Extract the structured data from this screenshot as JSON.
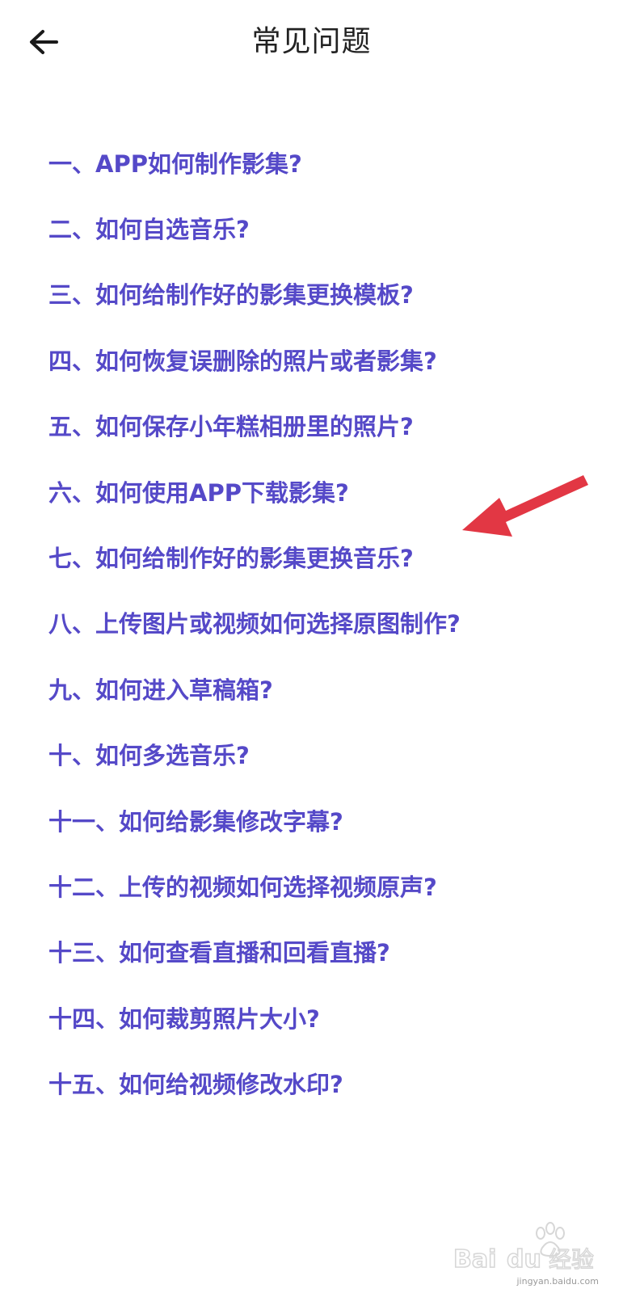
{
  "header": {
    "title": "常见问题"
  },
  "faq": {
    "items": [
      "一、APP如何制作影集?",
      "二、如何自选音乐?",
      "三、如何给制作好的影集更换模板?",
      "四、如何恢复误删除的照片或者影集?",
      "五、如何保存小年糕相册里的照片?",
      "六、如何使用APP下载影集?",
      "七、如何给制作好的影集更换音乐?",
      "八、上传图片或视频如何选择原图制作?",
      "九、如何进入草稿箱?",
      "十、如何多选音乐?",
      "十一、如何给影集修改字幕?",
      "十二、上传的视频如何选择视频原声?",
      "十三、如何查看直播和回看直播?",
      "十四、如何裁剪照片大小?",
      "十五、如何给视频修改水印?"
    ]
  },
  "theme": {
    "link_color": "#5549c8",
    "annotation_color": "#e23744"
  },
  "icons": {
    "back": "arrow-left-icon",
    "annotation": "red-arrow-annotation"
  },
  "watermark": {
    "brand": "Baidu经验",
    "url": "jingyan.baidu.com"
  }
}
